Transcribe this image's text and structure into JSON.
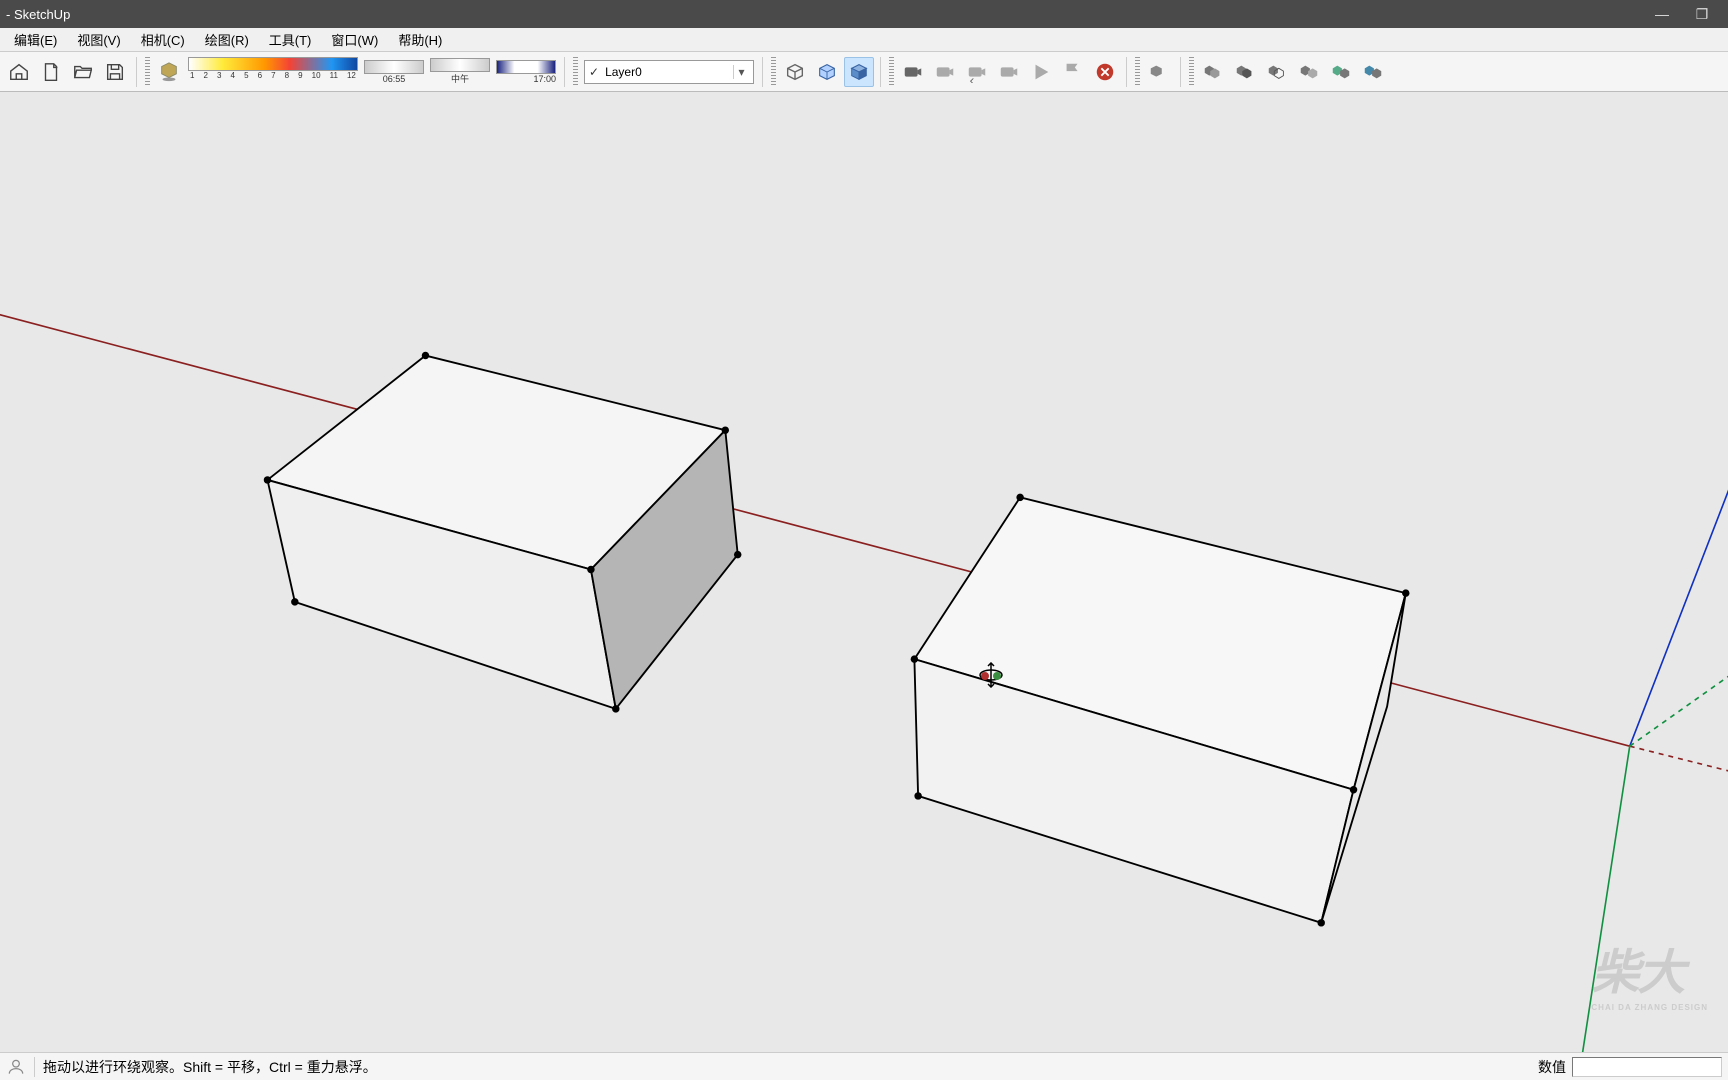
{
  "window": {
    "title": "- SketchUp",
    "minimize": "—",
    "maximize": "❐"
  },
  "menu": {
    "edit": "编辑(E)",
    "view": "视图(V)",
    "camera": "相机(C)",
    "draw": "绘图(R)",
    "tools": "工具(T)",
    "window": "窗口(W)",
    "help": "帮助(H)"
  },
  "shadow": {
    "months": [
      "1",
      "2",
      "3",
      "4",
      "5",
      "6",
      "7",
      "8",
      "9",
      "10",
      "11",
      "12"
    ],
    "time_start": "06:55",
    "noon": "中午",
    "time_end": "17:00"
  },
  "layer": {
    "selected": "Layer0"
  },
  "status": {
    "hint": "拖动以进行环绕观察。Shift = 平移，Ctrl = 重力悬浮。",
    "value_label": "数值",
    "value": ""
  },
  "watermark": {
    "main": "柴大",
    "sub": "CHAI DA ZHANG DESIGN"
  }
}
